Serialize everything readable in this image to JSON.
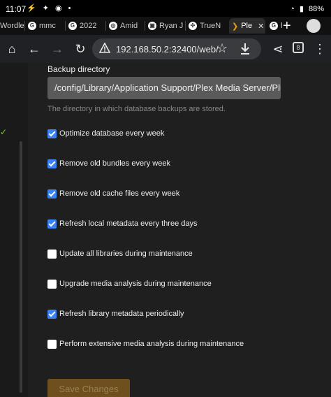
{
  "status_bar": {
    "time": "11:07",
    "battery": "88%"
  },
  "tabs": [
    {
      "label": "Wordle"
    },
    {
      "label": "mmc"
    },
    {
      "label": "2022"
    },
    {
      "label": "Amid"
    },
    {
      "label": "Ryan J"
    },
    {
      "label": "TrueN"
    },
    {
      "label": "Ple"
    },
    {
      "label": "he"
    }
  ],
  "toolbar": {
    "url": "192.168.50.2:32400/web/",
    "tab_count": "8"
  },
  "settings": {
    "backup_label": "Backup directory",
    "backup_value": "/config/Library/Application Support/Plex Media Server/Plug-",
    "backup_help": "The directory in which database backups are stored.",
    "options": [
      {
        "label": "Optimize database every week",
        "checked": true
      },
      {
        "label": "Remove old bundles every week",
        "checked": true
      },
      {
        "label": "Remove old cache files every week",
        "checked": true
      },
      {
        "label": "Refresh local metadata every three days",
        "checked": true
      },
      {
        "label": "Update all libraries during maintenance",
        "checked": false
      },
      {
        "label": "Upgrade media analysis during maintenance",
        "checked": false
      },
      {
        "label": "Refresh library metadata periodically",
        "checked": true
      },
      {
        "label": "Perform extensive media analysis during maintenance",
        "checked": false
      }
    ],
    "save_label": "Save Changes"
  },
  "colors": {
    "accent": "#3b82f6",
    "save": "#9a6a1e",
    "check": "#8cc63f"
  }
}
